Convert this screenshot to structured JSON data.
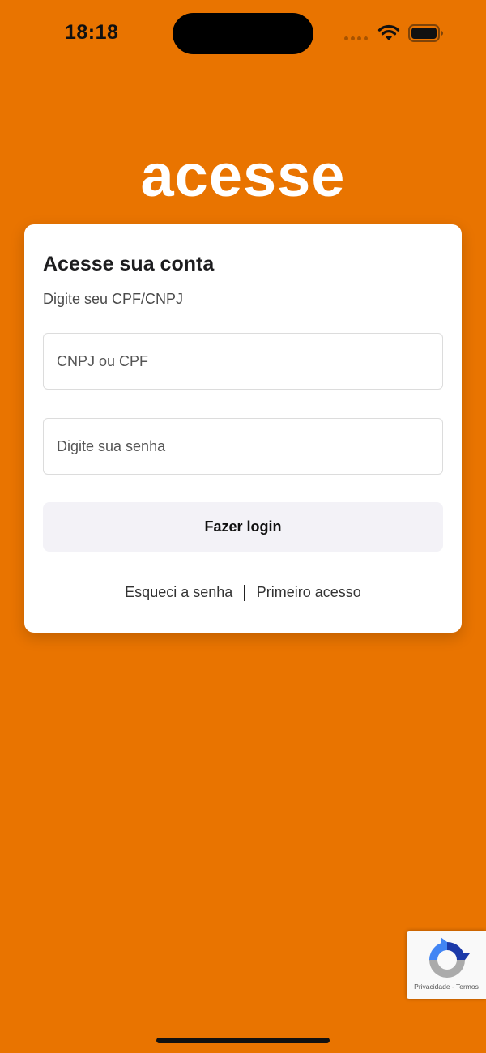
{
  "status_bar": {
    "time": "18:18",
    "icons": [
      "signal-dots-icon",
      "wifi-icon",
      "battery-icon"
    ]
  },
  "logo": {
    "text": "acesse"
  },
  "login_card": {
    "title": "Acesse sua conta",
    "subtitle": "Digite seu CPF/CNPJ",
    "document_field": {
      "placeholder": "CNPJ ou CPF",
      "value": ""
    },
    "password_field": {
      "placeholder": "Digite sua senha",
      "value": ""
    },
    "login_button": "Fazer login",
    "links": {
      "forgot_password": "Esqueci a senha",
      "first_access": "Primeiro acesso"
    }
  },
  "recaptcha": {
    "text": "Privacidade - Termos"
  },
  "colors": {
    "background": "#E97400",
    "card": "#FFFFFF",
    "button": "#F3F2F7"
  }
}
